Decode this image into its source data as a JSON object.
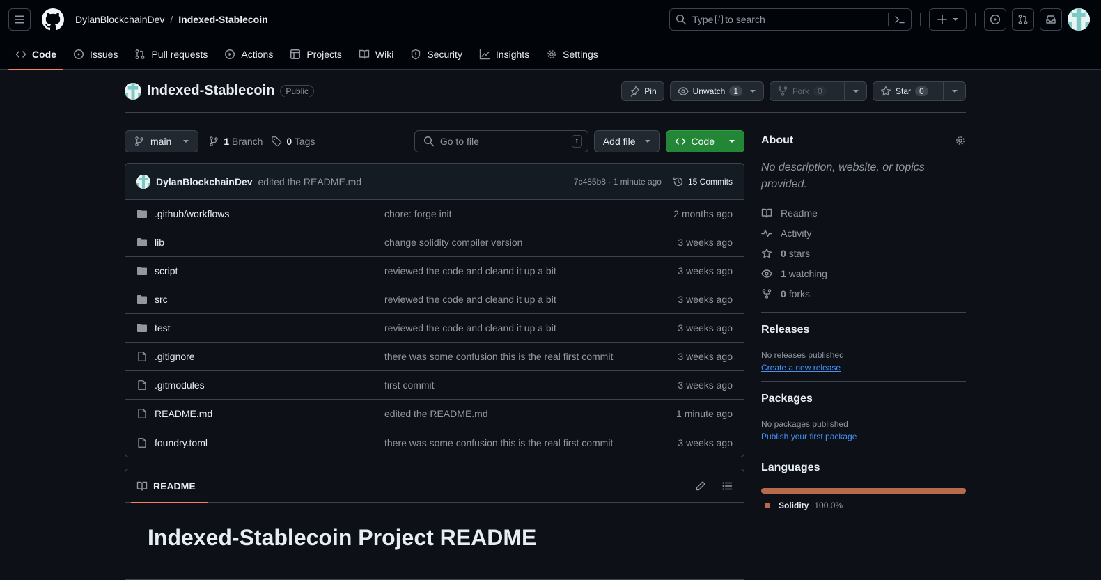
{
  "header": {
    "owner": "DylanBlockchainDev",
    "separator": "/",
    "repo": "Indexed-Stablecoin",
    "search": {
      "prefix": "Type",
      "key": "/",
      "suffix": "to search"
    }
  },
  "nav": [
    {
      "label": "Code",
      "icon": "code-icon",
      "active": true
    },
    {
      "label": "Issues",
      "icon": "issue-icon"
    },
    {
      "label": "Pull requests",
      "icon": "pull-request-icon"
    },
    {
      "label": "Actions",
      "icon": "actions-icon"
    },
    {
      "label": "Projects",
      "icon": "projects-icon"
    },
    {
      "label": "Wiki",
      "icon": "book-icon"
    },
    {
      "label": "Security",
      "icon": "shield-icon"
    },
    {
      "label": "Insights",
      "icon": "graph-icon"
    },
    {
      "label": "Settings",
      "icon": "gear-icon"
    }
  ],
  "repo": {
    "title": "Indexed-Stablecoin",
    "visibility": "Public",
    "pin_label": "Pin",
    "watch_label": "Unwatch",
    "watch_count": "1",
    "fork_label": "Fork",
    "fork_count": "0",
    "star_label": "Star",
    "star_count": "0"
  },
  "toolbar": {
    "branch": "main",
    "branch_count": "1",
    "branch_label": "Branch",
    "tag_count": "0",
    "tag_label": "Tags",
    "goto_placeholder": "Go to file",
    "goto_key": "t",
    "add_file": "Add file",
    "code": "Code"
  },
  "latest_commit": {
    "author": "DylanBlockchainDev",
    "message": "edited the README.md",
    "sha_time": "7c485b8 · 1 minute ago",
    "commits_label": "15 Commits"
  },
  "files": [
    {
      "type": "dir",
      "name": ".github/workflows",
      "message": "chore: forge init",
      "date": "2 months ago"
    },
    {
      "type": "dir",
      "name": "lib",
      "message": "change solidity compiler version",
      "date": "3 weeks ago"
    },
    {
      "type": "dir",
      "name": "script",
      "message": "reviewed the code and cleand it up a bit",
      "date": "3 weeks ago"
    },
    {
      "type": "dir",
      "name": "src",
      "message": "reviewed the code and cleand it up a bit",
      "date": "3 weeks ago"
    },
    {
      "type": "dir",
      "name": "test",
      "message": "reviewed the code and cleand it up a bit",
      "date": "3 weeks ago"
    },
    {
      "type": "file",
      "name": ".gitignore",
      "message": "there was some confusion this is the real first commit",
      "date": "3 weeks ago"
    },
    {
      "type": "file",
      "name": ".gitmodules",
      "message": "first commit",
      "date": "3 weeks ago"
    },
    {
      "type": "file",
      "name": "README.md",
      "message": "edited the README.md",
      "date": "1 minute ago"
    },
    {
      "type": "file",
      "name": "foundry.toml",
      "message": "there was some confusion this is the real first commit",
      "date": "3 weeks ago"
    }
  ],
  "readme": {
    "tab": "README",
    "heading": "Indexed-Stablecoin Project README"
  },
  "sidebar": {
    "about_title": "About",
    "about_desc": "No description, website, or topics provided.",
    "readme": "Readme",
    "activity": "Activity",
    "stars_count": "0",
    "stars_label": "stars",
    "watching_count": "1",
    "watching_label": "watching",
    "forks_count": "0",
    "forks_label": "forks",
    "releases_title": "Releases",
    "releases_text": "No releases published",
    "releases_link": "Create a new release",
    "packages_title": "Packages",
    "packages_text": "No packages published",
    "packages_link": "Publish your first package",
    "languages_title": "Languages",
    "language_name": "Solidity",
    "language_pct": "100.0%",
    "language_color": "#b76b4c"
  },
  "colors": {
    "accent_underline": "#f78166",
    "code_button": "#238636",
    "link": "#4493f8"
  }
}
